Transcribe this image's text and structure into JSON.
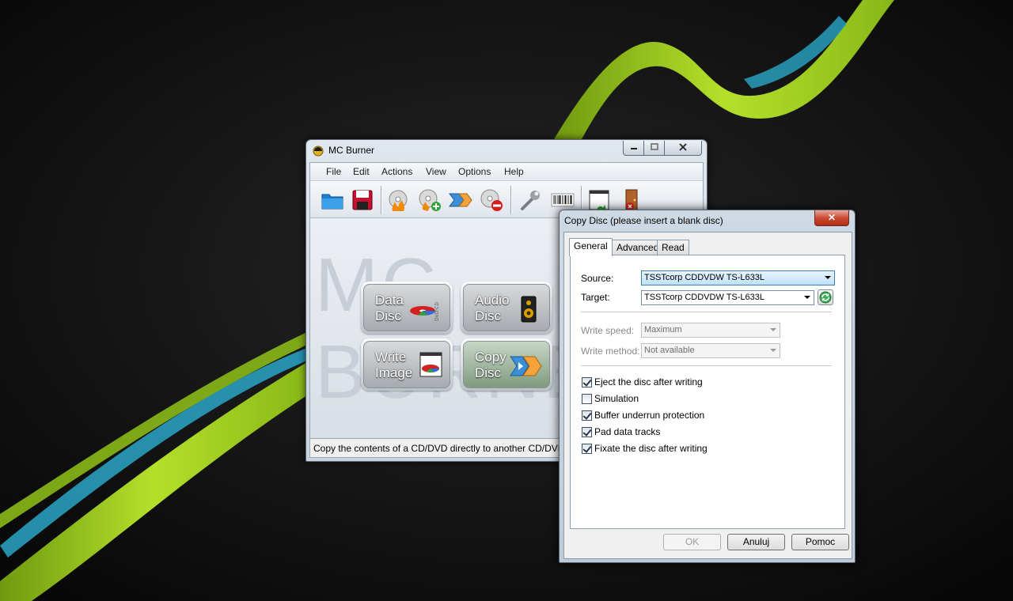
{
  "mcburner": {
    "title": "MC Burner",
    "menu": [
      "File",
      "Edit",
      "Actions",
      "View",
      "Options",
      "Help"
    ],
    "toolbar_icons": [
      "open-folder-icon",
      "save-icon",
      "burn-disc-icon",
      "add-disc-icon",
      "copy-disc-icon",
      "erase-disc-icon",
      "wrench-icon",
      "barcode-icon",
      "window-icon",
      "exit-door-icon"
    ],
    "watermark": "MC BURNER",
    "big_buttons": {
      "data_disc": [
        "Data",
        "Disc"
      ],
      "audio_disc": [
        "Audio",
        "Disc"
      ],
      "write_image": [
        "Write",
        "Image"
      ],
      "copy_disc": [
        "Copy",
        "Disc"
      ]
    },
    "status": "Copy the contents of a CD/DVD directly to another CD/DVD"
  },
  "dialog": {
    "title": "Copy Disc (please insert a blank disc)",
    "close": "✕",
    "tabs": [
      "General",
      "Advanced",
      "Read"
    ],
    "source_label": "Source:",
    "source_value": "TSSTcorp CDDVDW TS-L633L",
    "target_label": "Target:",
    "target_value": "TSSTcorp CDDVDW TS-L633L",
    "write_speed_label": "Write speed:",
    "write_speed_value": "Maximum",
    "write_method_label": "Write method:",
    "write_method_value": "Not available",
    "checkboxes": [
      {
        "label": "Eject the disc after writing",
        "checked": true
      },
      {
        "label": "Simulation",
        "checked": false
      },
      {
        "label": "Buffer underrun protection",
        "checked": true
      },
      {
        "label": "Pad data tracks",
        "checked": true
      },
      {
        "label": "Fixate the disc after writing",
        "checked": true
      }
    ],
    "buttons": {
      "ok": "OK",
      "cancel": "Anuluj",
      "help": "Pomoc"
    }
  },
  "colors": {
    "wallpaper": "#0e0e0e",
    "ribbon_green": "#9acd1e",
    "ribbon_cyan": "#2aa6c8",
    "dialog_close": "#c9452d"
  }
}
